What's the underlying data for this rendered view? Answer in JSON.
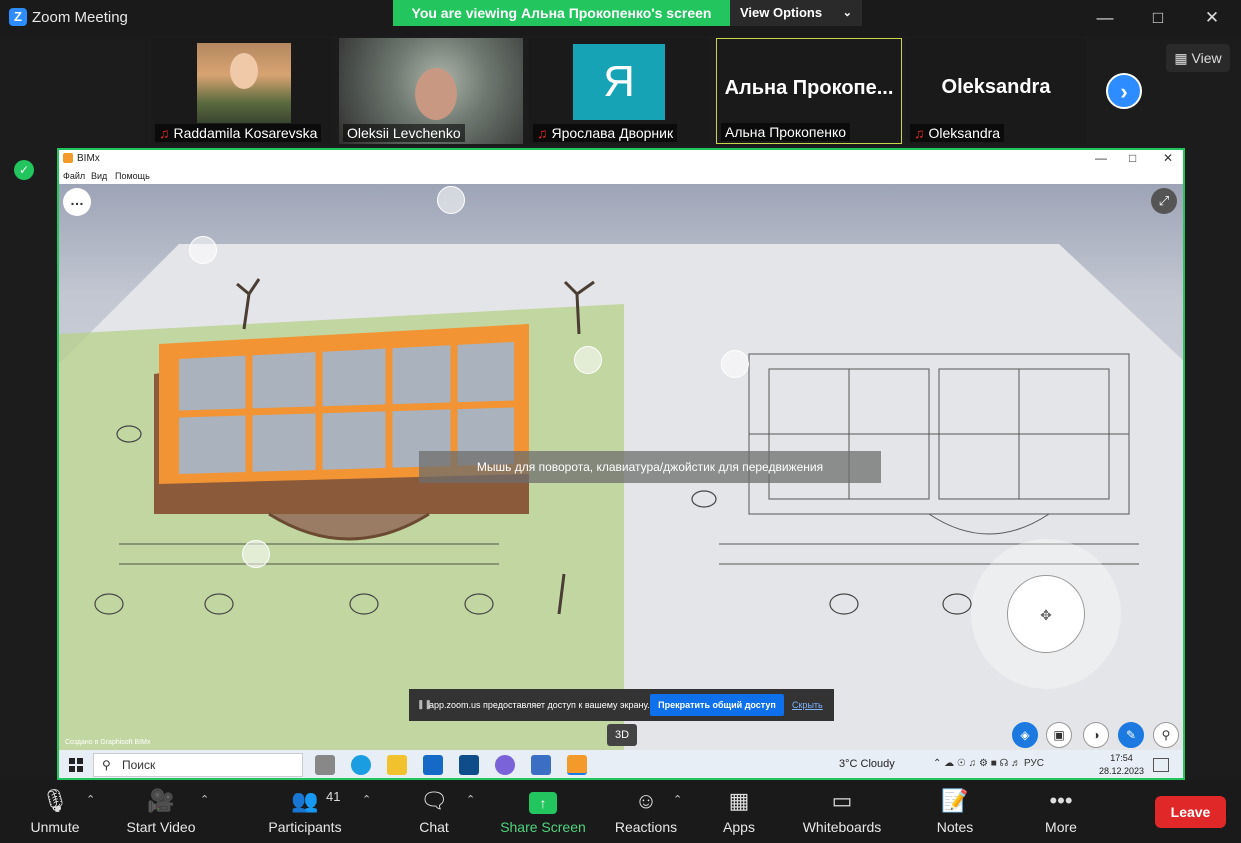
{
  "titlebar": {
    "title": "Zoom Meeting",
    "logo_letter": "Z"
  },
  "banner": {
    "text": "You are viewing Альна Прокопенко's screen",
    "view_options": "View Options"
  },
  "participants_strip": {
    "tiles": [
      {
        "name": "Raddamila Kosarevska",
        "muted": true
      },
      {
        "name": "Oleksii Levchenko",
        "muted": false
      },
      {
        "name": "Ярослава Дворник",
        "muted": true,
        "avatar_letter": "Я"
      },
      {
        "name": "Альна Прокопенко",
        "muted": false,
        "display_name": "Альна Прокопе..."
      },
      {
        "name": "Oleksandra",
        "muted": true,
        "display_name": "Oleksandra"
      }
    ],
    "view_label": "View"
  },
  "shared_app": {
    "title": "BIMx",
    "menu": [
      "Файл",
      "Вид",
      "Помощь"
    ],
    "hint": "Мышь для поворота, клавиатура/джойстик для передвижения",
    "share_bar": {
      "message": "app.zoom.us предоставляет доступ к вашему экрану.",
      "stop_label": "Прекратить общий доступ",
      "hide_label": "Скрыть"
    },
    "mode_3d": "3D",
    "credit": "Создано в Graphisoft BIMx"
  },
  "taskbar": {
    "search_placeholder": "Поиск",
    "weather": "3°C  Cloudy",
    "lang": "РУС",
    "time": "17:54",
    "date": "28.12.2023"
  },
  "toolbar": {
    "unmute": "Unmute",
    "start_video": "Start Video",
    "participants": "Participants",
    "participants_count": "41",
    "chat": "Chat",
    "share_screen": "Share Screen",
    "reactions": "Reactions",
    "apps": "Apps",
    "whiteboards": "Whiteboards",
    "notes": "Notes",
    "more": "More",
    "leave": "Leave"
  },
  "colors": {
    "accent_green": "#23c55e",
    "leave_red": "#e02828",
    "zoom_blue": "#2d8cff"
  }
}
